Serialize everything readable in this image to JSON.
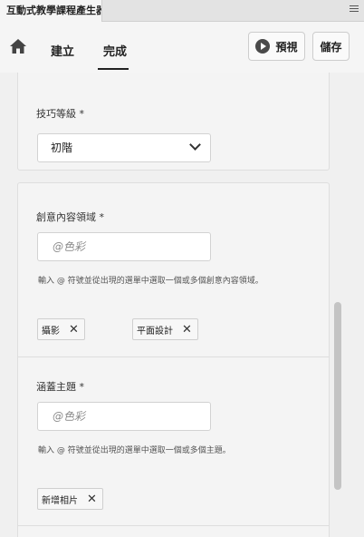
{
  "panel": {
    "title": "互動式教學課程產生器"
  },
  "nav": {
    "create_label": "建立",
    "done_label": "完成"
  },
  "toolbar": {
    "preview_label": "預視",
    "save_label": "儲存"
  },
  "skill": {
    "label": "技巧等級 *",
    "selected": "初階"
  },
  "creative": {
    "label": "創意內容領域 *",
    "placeholder": "@色彩",
    "hint": "輸入 @ 符號並從出現的選單中選取一個或多個創意內容領域。",
    "tags": [
      "攝影",
      "平面設計"
    ]
  },
  "topics": {
    "label": "涵蓋主題 *",
    "placeholder": "@色彩",
    "hint": "輸入 @ 符號並從出現的選單中選取一個或多個主題。",
    "tags": [
      "新增相片"
    ]
  },
  "chip_remove_glyph": "✕"
}
